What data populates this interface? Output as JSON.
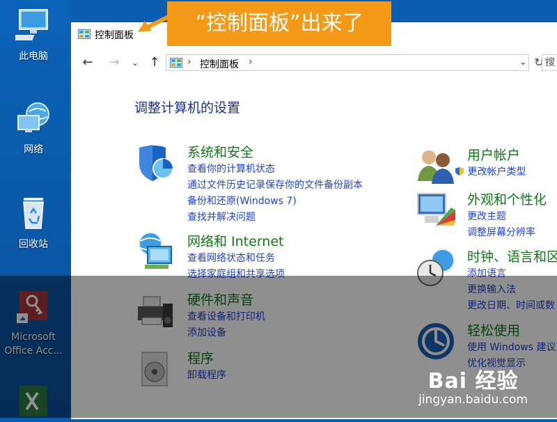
{
  "desktop": {
    "icons": [
      {
        "label": "此电脑"
      },
      {
        "label": "网络"
      },
      {
        "label": "回收站"
      },
      {
        "label": "Microsoft Office Acc..."
      }
    ]
  },
  "window": {
    "title": "控制面板",
    "address": {
      "crumb": "控制面板",
      "search_placeholder": "搜"
    },
    "heading": "调整计算机的设置",
    "categories": [
      {
        "title": "系统和安全",
        "links": [
          "查看你的计算机状态",
          "通过文件历史记录保存你的文件备份副本",
          "备份和还原(Windows 7)",
          "查找并解决问题"
        ]
      },
      {
        "title": "网络和 Internet",
        "links": [
          "查看网络状态和任务",
          "选择家庭组和共享选项"
        ]
      },
      {
        "title": "硬件和声音",
        "links": [
          "查看设备和打印机",
          "添加设备"
        ]
      },
      {
        "title": "程序",
        "links": [
          "卸载程序"
        ]
      },
      {
        "title": "用户帐户",
        "links": [
          "更改帐户类型"
        ]
      },
      {
        "title": "外观和个性化",
        "links": [
          "更改主题",
          "调整屏幕分辨率"
        ]
      },
      {
        "title": "时钟、语言和区",
        "links": [
          "添加语言",
          "更换输入法",
          "更改日期、时间或数"
        ]
      },
      {
        "title": "轻松使用",
        "links": [
          "使用 Windows 建议",
          "优化视觉显示"
        ]
      }
    ]
  },
  "callout": {
    "text": "“控制面板”出来了"
  },
  "watermark": {
    "brand": "Bai 经验",
    "url": "jingyan.baidu.com"
  },
  "colors": {
    "accent": "#f59a16",
    "link": "#2244cc",
    "category_title": "#0e7a15",
    "heading": "#1e3287"
  }
}
